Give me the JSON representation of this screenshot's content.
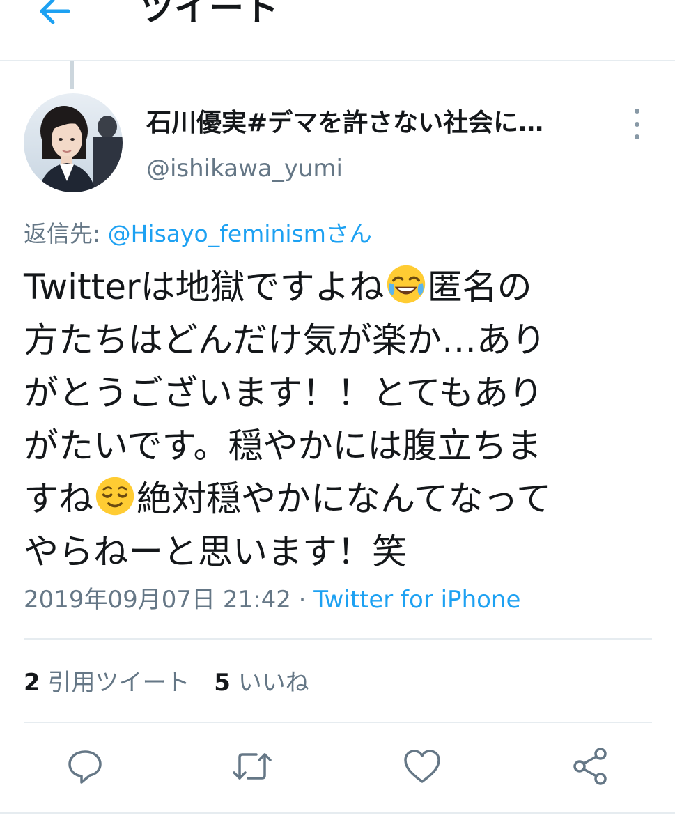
{
  "header": {
    "title": "ツイート",
    "back_icon": "arrow-left-icon"
  },
  "tweet": {
    "author": {
      "display_name": "石川優実#デマを許さない社会に…",
      "username": "@ishikawa_yumi"
    },
    "reply_to": {
      "label": "返信先: ",
      "mention": "@Hisayo_feminismさん"
    },
    "text_lines": [
      {
        "before": "Twitterは地獄ですよね",
        "emoji": "face-with-tears-of-joy",
        "after": "匿名の"
      },
      {
        "before": "方たちはどんだけ気が楽か…あり",
        "emoji": null,
        "after": ""
      },
      {
        "before": "がとうございます！！とてもあり",
        "emoji": null,
        "after": ""
      },
      {
        "before": "がたいです。穏やかには腹立ちま",
        "emoji": null,
        "after": ""
      },
      {
        "before": "すね",
        "emoji": "relieved-face",
        "after": "絶対穏やかになんてなって"
      },
      {
        "before": "やらねーと思います！笑",
        "emoji": null,
        "after": ""
      }
    ],
    "timestamp": "2019年09月07日 21:42",
    "separator": " · ",
    "source": "Twitter for iPhone",
    "stats": {
      "quote_count": "2",
      "quote_label": "引用ツイート",
      "like_count": "5",
      "like_label": "いいね"
    }
  },
  "actions": {
    "reply_icon": "reply-icon",
    "retweet_icon": "retweet-icon",
    "like_icon": "heart-icon",
    "share_icon": "share-icon"
  },
  "colors": {
    "accent": "#1da1f2",
    "secondary_text": "#657786",
    "divider": "#e6ecf0"
  }
}
